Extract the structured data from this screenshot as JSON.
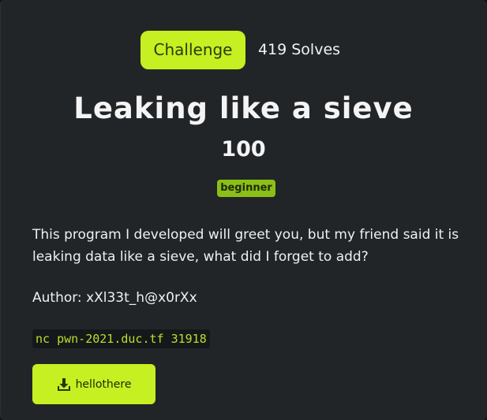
{
  "tabs": {
    "challenge_label": "Challenge",
    "solves_label": "419 Solves"
  },
  "challenge": {
    "title": "Leaking like a sieve",
    "points": "100",
    "tag": "beginner",
    "description": "This program I developed will greet you, but my friend said it is leaking data like a sieve, what did I forget to add?",
    "author": "Author: xXl33t_h@x0rXx",
    "connection": "nc pwn-2021.duc.tf 31918"
  },
  "files": {
    "download_label": "hellothere",
    "download_icon": "download-icon"
  },
  "colors": {
    "accent": "#c6f022",
    "tag_bg": "#8bbf17",
    "modal_bg": "#222528",
    "code_text": "#b6e02a"
  }
}
